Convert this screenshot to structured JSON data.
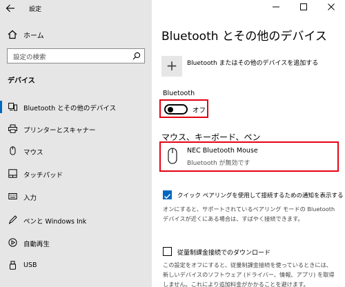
{
  "window": {
    "title": "設定"
  },
  "sidebar": {
    "home_label": "ホーム",
    "search_placeholder": "設定の検索",
    "section_label": "デバイス",
    "items": [
      {
        "label": "Bluetooth とその他のデバイス",
        "icon": "bluetooth-devices-icon",
        "active": true
      },
      {
        "label": "プリンターとスキャナー",
        "icon": "printer-icon"
      },
      {
        "label": "マウス",
        "icon": "mouse-icon"
      },
      {
        "label": "タッチパッド",
        "icon": "touchpad-icon"
      },
      {
        "label": "入力",
        "icon": "keyboard-icon"
      },
      {
        "label": "ペンと Windows Ink",
        "icon": "pen-icon"
      },
      {
        "label": "自動再生",
        "icon": "autoplay-icon"
      },
      {
        "label": "USB",
        "icon": "usb-icon"
      }
    ]
  },
  "main": {
    "title": "Bluetooth とその他のデバイス",
    "add_device_label": "Bluetooth またはその他のデバイスを追加する",
    "bluetooth_label": "Bluetooth",
    "bluetooth_toggle_text": "オフ",
    "bluetooth_on": false,
    "mouse_section_title": "マウス、キーボード、ペン",
    "device": {
      "name": "NEC Bluetooth Mouse",
      "status": "Bluetooth が無効です"
    },
    "swift_pair": {
      "checked": true,
      "label": "クイック ペアリングを使用して接続するための通知を表示する",
      "desc_line1": "オンにすると、サポートされているペアリング モードの Bluetooth",
      "desc_line2": "デバイスが近くにある場合は、すばやく接続できます。"
    },
    "metered": {
      "checked": false,
      "label": "従量制課金接続でのダウンロード",
      "desc_line1": "この設定をオフにすると、従量制課金接続を使っているときには、",
      "desc_line2": "新しいデバイスのソフトウェア (ドライバー、情報、アプリ) を取得",
      "desc_line3": "しません。これにより追加料金がかかることを避けます。"
    }
  },
  "colors": {
    "accent": "#0067c0",
    "highlight_box": "#e60012",
    "sidebar_bg": "#e6e6e6"
  }
}
